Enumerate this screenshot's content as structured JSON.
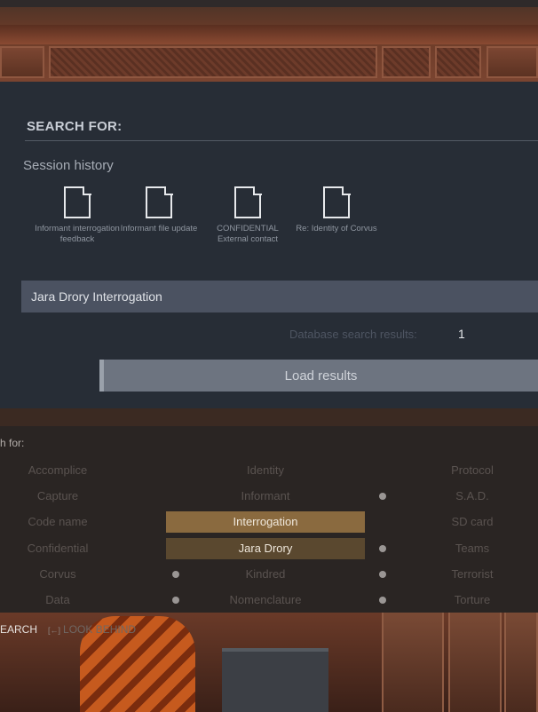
{
  "upper": {
    "heading": "SEARCH FOR:",
    "session_title": "Session history",
    "documents": [
      {
        "icon": "document-icon",
        "label": "Informant interrogation feedback"
      },
      {
        "icon": "document-icon",
        "label": "Informant file update"
      },
      {
        "icon": "document-icon",
        "label": "CONFIDENTIAL External contact"
      },
      {
        "icon": "document-icon",
        "label": "Re: Identity of Corvus"
      }
    ],
    "query": "Jara Drory  Interrogation",
    "results_label": "Database search results:",
    "results_count": "1",
    "load_button": "Load results"
  },
  "lower": {
    "title": "h for:",
    "rows": [
      [
        "Accomplice",
        "Identity",
        "Protocol"
      ],
      [
        "Capture",
        "Informant",
        "S.A.D."
      ],
      [
        "Code name",
        "Interrogation",
        "SD card"
      ],
      [
        "Confidential",
        "Jara Drory",
        "Teams"
      ],
      [
        "Corvus",
        "Kindred",
        "Terrorist"
      ],
      [
        "Data",
        "Nomenclature",
        "Torture"
      ]
    ],
    "footer_search": "EARCH",
    "footer_look_key": "[←]",
    "footer_look": "LOOK BEHIND"
  },
  "colors": {
    "panel": "#272d36",
    "query_bar": "#4b5261",
    "load_button": "#6d7480",
    "selected_primary": "#8a6a3f",
    "selected_secondary": "#5a482f"
  }
}
